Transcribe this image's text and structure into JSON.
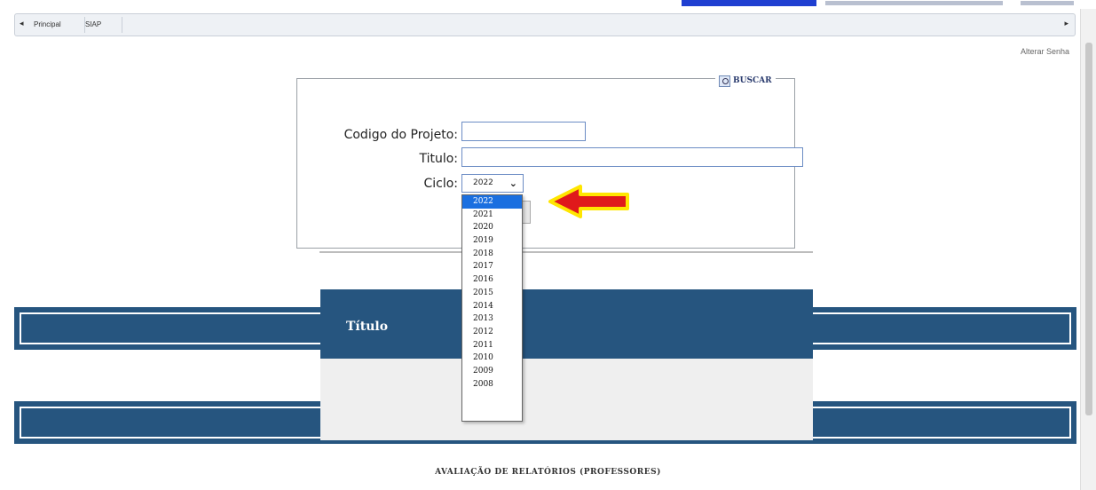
{
  "tabs": [
    "Principal",
    "SIAP"
  ],
  "header_link": "Alterar Senha",
  "search": {
    "legend": "BUSCAR",
    "fields": {
      "codigo_label": "Codigo do Projeto:",
      "titulo_label": "Titulo:",
      "ciclo_label": "Ciclo:",
      "codigo_value": "",
      "titulo_value": ""
    },
    "ciclo_selected": "2022",
    "ciclo_options": [
      "2022",
      "2021",
      "2020",
      "2019",
      "2018",
      "2017",
      "2016",
      "2015",
      "2014",
      "2013",
      "2012",
      "2011",
      "2010",
      "2009",
      "2008"
    ]
  },
  "panel": {
    "title": "Título"
  },
  "footer": "AVALIAÇÃO DE RELATÓRIOS (PROFESSORES)",
  "colors": {
    "band": "#26557f",
    "arrow_fill": "#e0191b",
    "arrow_outline": "#ffe600",
    "selected_option": "#1a6fe0"
  }
}
